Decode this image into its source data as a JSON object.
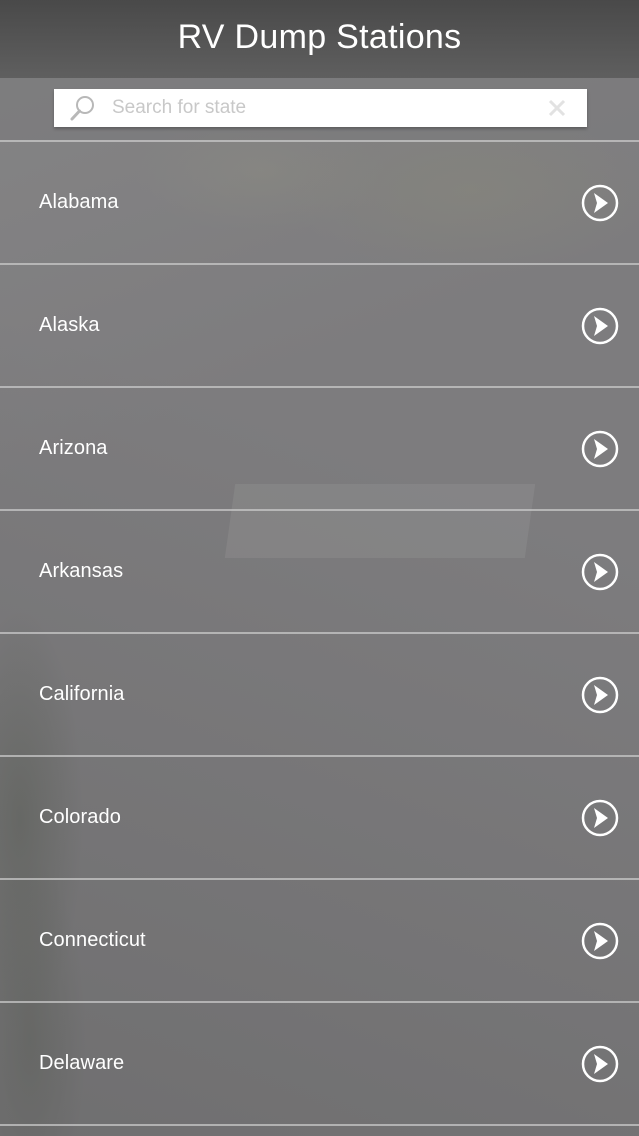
{
  "header": {
    "title": "RV Dump Stations"
  },
  "search": {
    "placeholder": "Search for state",
    "value": "",
    "icon": "search-icon",
    "clear_icon": "clear-icon"
  },
  "states": {
    "items": [
      {
        "label": "Alabama",
        "icon": "chevron-right-circle-icon"
      },
      {
        "label": "Alaska",
        "icon": "chevron-right-circle-icon"
      },
      {
        "label": "Arizona",
        "icon": "chevron-right-circle-icon"
      },
      {
        "label": "Arkansas",
        "icon": "chevron-right-circle-icon"
      },
      {
        "label": "California",
        "icon": "chevron-right-circle-icon"
      },
      {
        "label": "Colorado",
        "icon": "chevron-right-circle-icon"
      },
      {
        "label": "Connecticut",
        "icon": "chevron-right-circle-icon"
      },
      {
        "label": "Delaware",
        "icon": "chevron-right-circle-icon"
      }
    ]
  },
  "colors": {
    "header_bg": "#4a4a4a",
    "text": "#ffffff",
    "divider": "#c8c8c8"
  }
}
